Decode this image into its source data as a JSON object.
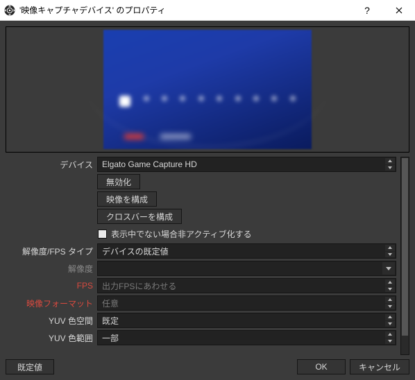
{
  "window": {
    "title": "'映像キャプチャデバイス' のプロパティ"
  },
  "form": {
    "device": {
      "label": "デバイス",
      "value": "Elgato Game Capture HD"
    },
    "buttons": {
      "disable": "無効化",
      "configure_video": "映像を構成",
      "configure_crossbar": "クロスバーを構成"
    },
    "checkbox_deactivate_when_not_showing": "表示中でない場合非アクティブ化する",
    "res_fps_type": {
      "label": "解像度/FPS タイプ",
      "value": "デバイスの既定値"
    },
    "resolution": {
      "label": "解像度",
      "value": ""
    },
    "fps": {
      "label": "FPS",
      "value": "出力FPSにあわせる"
    },
    "video_format": {
      "label": "映像フォーマット",
      "value": "任意"
    },
    "yuv_color_space": {
      "label": "YUV 色空間",
      "value": "既定"
    },
    "yuv_color_range": {
      "label": "YUV 色範囲",
      "value": "一部"
    }
  },
  "footer": {
    "defaults": "既定値",
    "ok": "OK",
    "cancel": "キャンセル"
  }
}
